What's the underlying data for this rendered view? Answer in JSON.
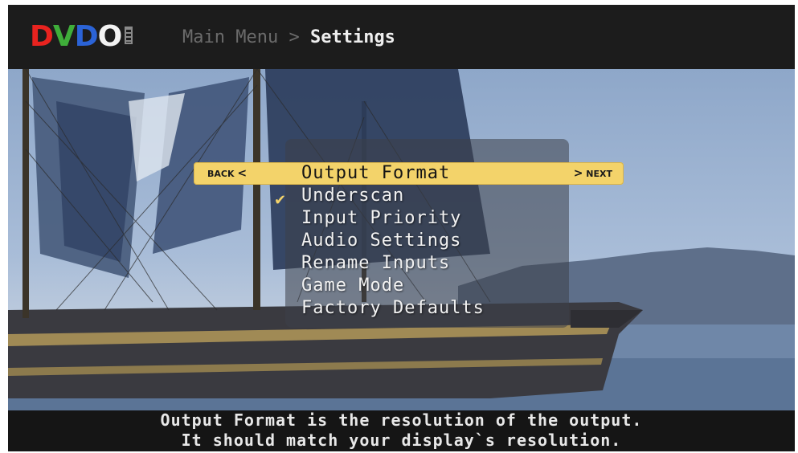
{
  "header": {
    "logo_letters": [
      "D",
      "V",
      "D",
      "O"
    ],
    "logo_colors": [
      "#e8231f",
      "#3fae3a",
      "#2b63d6",
      "#f2f2f2"
    ],
    "breadcrumb_parent": "Main Menu",
    "breadcrumb_separator": " > ",
    "breadcrumb_current": "Settings"
  },
  "menu": {
    "back_label": "BACK",
    "next_label": "NEXT",
    "items": [
      {
        "label": "Output Format"
      },
      {
        "label": "Underscan"
      },
      {
        "label": "Input Priority"
      },
      {
        "label": "Audio Settings"
      },
      {
        "label": "Rename Inputs"
      },
      {
        "label": "Game Mode"
      },
      {
        "label": "Factory Defaults"
      }
    ],
    "selected_index": 0,
    "checked_item": "Underscan",
    "highlight_color": "#f3d36a"
  },
  "footer": {
    "line1": "Output Format is the resolution of the output.",
    "line2": "It should match your display`s resolution."
  },
  "icons": {
    "back_arrow": "chevron-left-icon",
    "next_arrow": "chevron-right-icon",
    "check": "checkmark-icon"
  }
}
